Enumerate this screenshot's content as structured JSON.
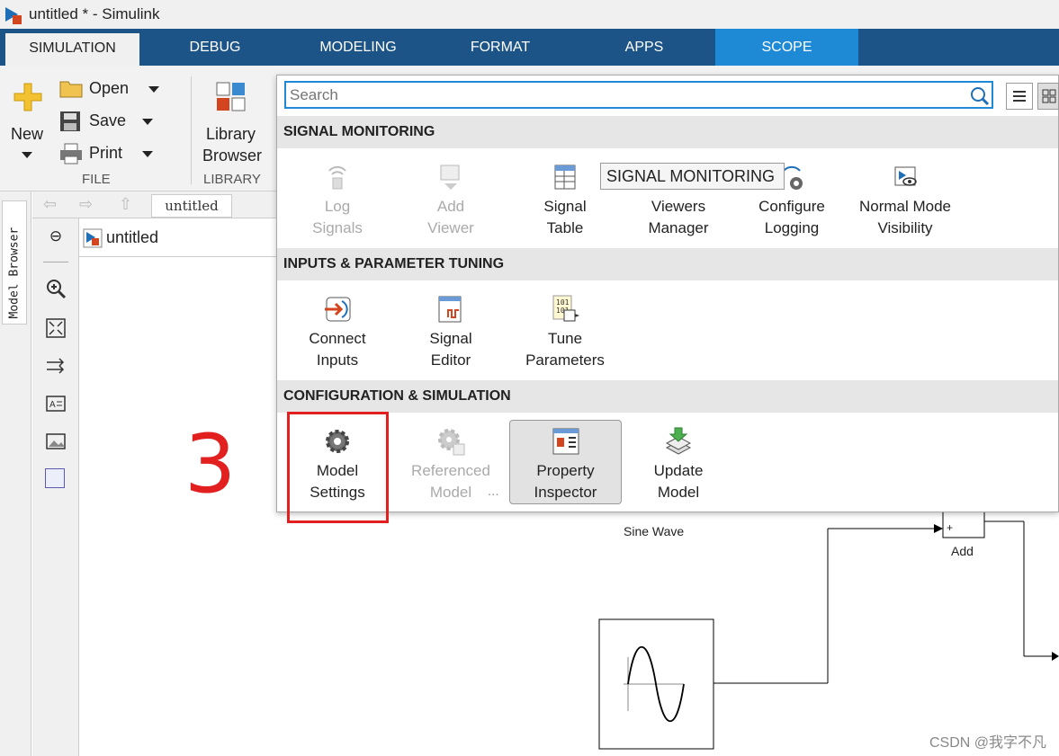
{
  "window": {
    "title": "untitled * - Simulink"
  },
  "tabs": [
    "SIMULATION",
    "DEBUG",
    "MODELING",
    "FORMAT",
    "APPS",
    "SCOPE"
  ],
  "ribbon": {
    "new_label": "New",
    "open_label": "Open",
    "save_label": "Save",
    "print_label": "Print",
    "file_group": "FILE",
    "library_browser_line1": "Library",
    "library_browser_line2": "Browser",
    "library_group": "LIBRARY"
  },
  "model_browser_label": "Model Browser",
  "breadcrumb": "untitled",
  "model_tab": "untitled",
  "popup": {
    "search_placeholder": "Search",
    "sections": {
      "signal_monitoring": "SIGNAL MONITORING",
      "inputs": "INPUTS & PARAMETER TUNING",
      "config": "CONFIGURATION & SIMULATION"
    },
    "signal_items": [
      {
        "l1": "Log",
        "l2": "Signals",
        "icon": "log-signals-icon"
      },
      {
        "l1": "Add",
        "l2": "Viewer",
        "icon": "add-viewer-icon"
      },
      {
        "l1": "Signal",
        "l2": "Table",
        "icon": "signal-table-icon"
      },
      {
        "l1": "Viewers",
        "l2": "Manager",
        "icon": "viewers-manager-icon"
      },
      {
        "l1": "Configure",
        "l2": "Logging",
        "icon": "configure-logging-icon"
      },
      {
        "l1": "Normal Mode",
        "l2": "Visibility",
        "icon": "normal-mode-visibility-icon"
      }
    ],
    "input_items": [
      {
        "l1": "Connect",
        "l2": "Inputs",
        "icon": "connect-inputs-icon"
      },
      {
        "l1": "Signal",
        "l2": "Editor",
        "icon": "signal-editor-icon"
      },
      {
        "l1": "Tune",
        "l2": "Parameters",
        "icon": "tune-parameters-icon"
      }
    ],
    "config_items": [
      {
        "l1": "Model",
        "l2": "Settings",
        "icon": "gear-icon"
      },
      {
        "l1": "Referenced",
        "l2": "Model",
        "extra": "...",
        "icon": "referenced-model-icon"
      },
      {
        "l1": "Property",
        "l2": "Inspector",
        "icon": "property-inspector-icon"
      },
      {
        "l1": "Update",
        "l2": "Model",
        "icon": "update-model-icon"
      }
    ],
    "tooltip": "SIGNAL MONITORING"
  },
  "annotation": "3",
  "blocks": {
    "sine_wave_top": "Sine Wave",
    "add": "Add",
    "add_sign": "+",
    "sine_wave_bottom": "Sine Wave"
  },
  "watermark": "CSDN @我字不凡",
  "colors": {
    "tabbar": "#1d5487",
    "scope_tab": "#1e8ad6",
    "annotation": "#e32020"
  }
}
